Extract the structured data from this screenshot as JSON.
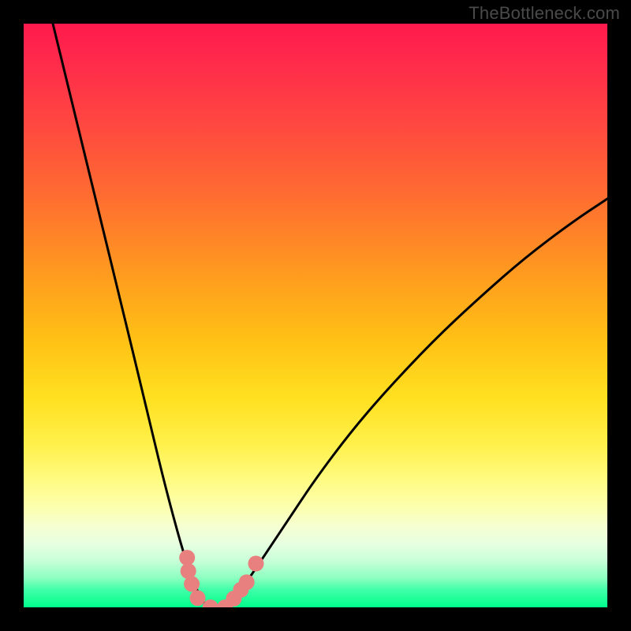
{
  "watermark": "TheBottleneck.com",
  "chart_data": {
    "type": "line",
    "title": "",
    "xlabel": "",
    "ylabel": "",
    "xlim": [
      0,
      1
    ],
    "ylim": [
      0,
      1
    ],
    "legend": false,
    "grid": false,
    "series": [
      {
        "name": "curve",
        "x": [
          0.05,
          0.089,
          0.128,
          0.167,
          0.206,
          0.244,
          0.283,
          0.311,
          0.325,
          0.339,
          0.356,
          0.38,
          0.42,
          0.46,
          0.5,
          0.56,
          0.62,
          0.7,
          0.78,
          0.86,
          0.94,
          1.0
        ],
        "y": [
          1.0,
          0.84,
          0.68,
          0.52,
          0.36,
          0.2,
          0.06,
          0.0,
          0.0,
          0.0,
          0.015,
          0.04,
          0.1,
          0.16,
          0.22,
          0.3,
          0.37,
          0.455,
          0.53,
          0.6,
          0.66,
          0.7
        ]
      }
    ],
    "markers": [
      {
        "name": "dot-cluster",
        "x": 0.28,
        "y": 0.085
      },
      {
        "name": "dot-cluster",
        "x": 0.282,
        "y": 0.062
      },
      {
        "name": "dot-cluster",
        "x": 0.288,
        "y": 0.04
      },
      {
        "name": "dot-cluster",
        "x": 0.298,
        "y": 0.016
      },
      {
        "name": "dot-cluster",
        "x": 0.32,
        "y": 0.0
      },
      {
        "name": "dot-cluster",
        "x": 0.345,
        "y": 0.0
      },
      {
        "name": "dot-cluster",
        "x": 0.36,
        "y": 0.015
      },
      {
        "name": "dot-cluster",
        "x": 0.372,
        "y": 0.03
      },
      {
        "name": "dot-cluster",
        "x": 0.382,
        "y": 0.043
      },
      {
        "name": "dot-cluster",
        "x": 0.398,
        "y": 0.075
      }
    ],
    "background_gradient": {
      "direction": "vertical",
      "stops": [
        {
          "pos": 0.0,
          "color": "#ff1a4d"
        },
        {
          "pos": 0.3,
          "color": "#ff6e30"
        },
        {
          "pos": 0.64,
          "color": "#ffe020"
        },
        {
          "pos": 0.86,
          "color": "#f6ffd0"
        },
        {
          "pos": 1.0,
          "color": "#00ff8c"
        }
      ]
    }
  }
}
